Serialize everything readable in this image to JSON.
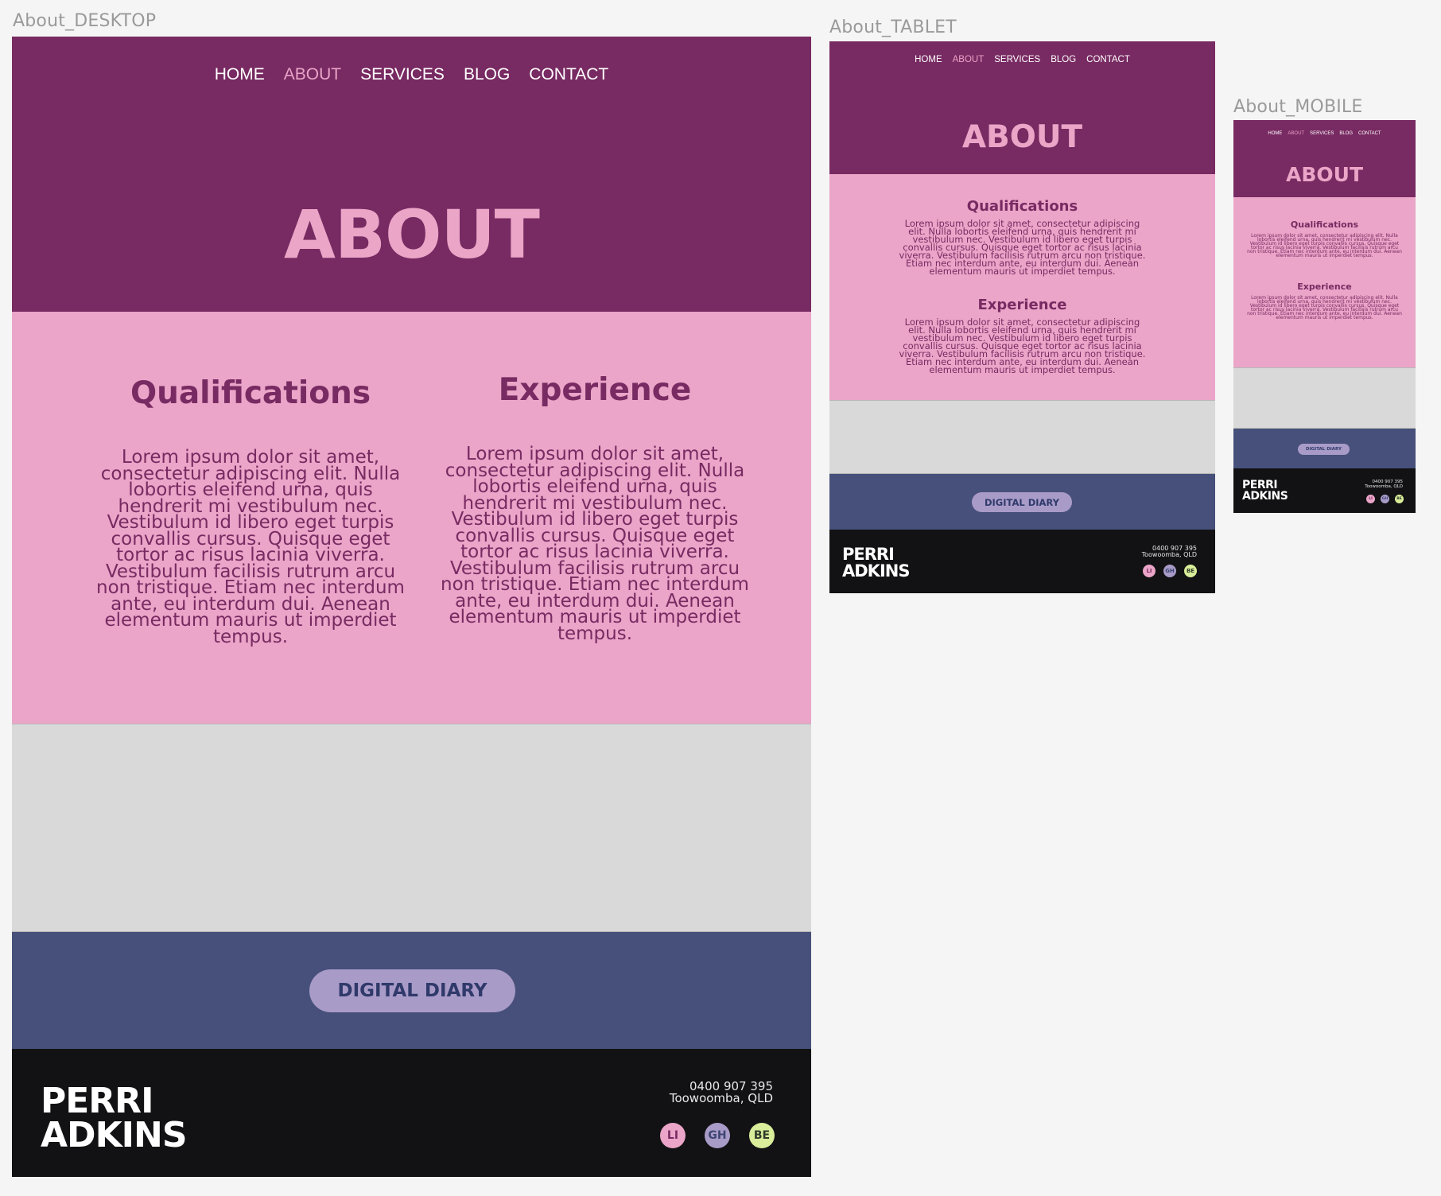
{
  "nav": {
    "home": "HOME",
    "about": "ABOUT",
    "services": "SERVICES",
    "blog": "BLOG",
    "contact": "CONTACT"
  },
  "frames": {
    "desktop": "About_DESKTOP",
    "tablet": "About_TABLET",
    "mobile": "About_MOBILE"
  },
  "hero": {
    "title": "ABOUT"
  },
  "sections": {
    "qualifications_title": "Qualifications",
    "experience_title": "Experience",
    "desktop_body": "Lorem ipsum dolor sit amet, consectetur adipiscing elit. Nulla lobortis eleifend urna, quis hendrerit mi vestibulum nec. Vestibulum id libero eget turpis convallis cursus. Quisque eget tortor ac risus lacinia viverra. Vestibulum facilisis rutrum arcu non tristique. Etiam nec interdum ante, eu interdum dui. Aenean elementum mauris ut imperdiet tempus.",
    "tablet_body": "Lorem ipsum dolor sit amet, consectetur adipiscing elit. Nulla lobortis eleifend urna, quis hendrerit mi vestibulum nec. Vestibulum id libero eget turpis convallis cursus. Quisque eget tortor ac risus lacinia viverra. Vestibulum facilisis rutrum arcu non tristique. Etiam nec interdum ante, eu interdum dui. Aenean elementum mauris ut imperdiet tempus.",
    "mobile_body": "Lorem ipsum dolor sit amet, consectetur adipiscing elit. Nulla lobortis eleifend urna, quis hendrerit mi vestibulum nec. Vestibulum id libero eget turpis convallis cursus. Quisque eget tortor ac risus lacinia viverra. Vestibulum facilisis rutrum arcu non tristique. Etiam nec interdum ante, eu interdum dui. Aenean elementum mauris ut imperdiet tempus."
  },
  "diary": {
    "label": "DIGITAL DIARY"
  },
  "footer": {
    "brand_line1": "PERRI",
    "brand_line2": "ADKINS",
    "phone": "0400 907 395",
    "location": "Toowoomba, QLD",
    "socials": [
      "LI",
      "GH",
      "BE"
    ]
  },
  "colors": {
    "plum": "#782a62",
    "pink": "#eaa5c8",
    "grey": "#d9d9d9",
    "navy": "#46507a",
    "lavender": "#a99bc8",
    "footer": "#121214",
    "lime": "#d9ed9a"
  }
}
